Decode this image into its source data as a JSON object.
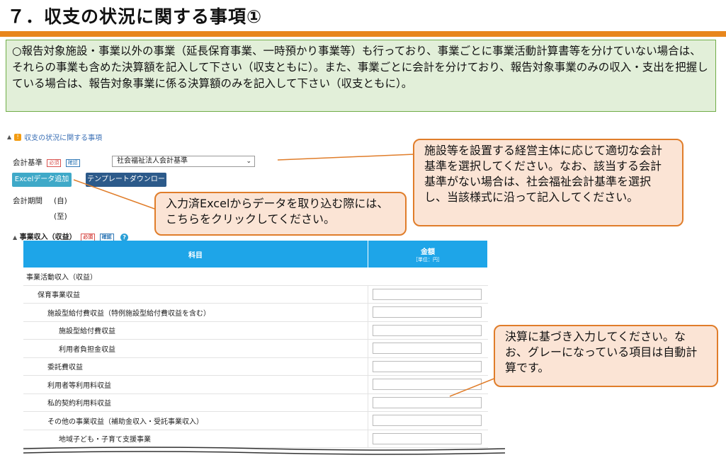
{
  "page": {
    "title": "７．収支の状況に関する事項①",
    "notice": "○報告対象施設・事業以外の事業（延長保育事業、一時預かり事業等）も行っており、事業ごとに事業活動計算書等を分けていない場合は、それらの事業も含めた決算額を記入して下さい（収支ともに）。また、事業ごとに会計を分けており、報告対象事業のみの収入・支出を把握している場合は、報告対象事業に係る決算額のみを記入して下さい（収支ともに）。"
  },
  "form": {
    "section_title": "収支の状況に関する事項",
    "accounting_label": "会計基準",
    "badge_required": "必須",
    "badge_check": "確認",
    "accounting_value": "社会福祉法人会計基準",
    "excel_button": "Excelデータ追加",
    "template_button": "テンプレートダウンロード",
    "period_label": "会計期間",
    "period_from": "(自)",
    "period_to": "(至)",
    "revenue_section": "事業収入（収益）",
    "help": "?"
  },
  "table": {
    "col_item": "科目",
    "col_amount": "金額",
    "col_unit": "［単位：円］",
    "rows": [
      {
        "label": "事業活動収入（収益）"
      },
      {
        "label": "保育事業収益"
      },
      {
        "label": "施設型給付費収益（特例施設型給付費収益を含む）"
      },
      {
        "label": "施設型給付費収益"
      },
      {
        "label": "利用者負担金収益"
      },
      {
        "label": "委託費収益"
      },
      {
        "label": "利用者等利用料収益"
      },
      {
        "label": "私的契約利用料収益"
      },
      {
        "label": "その他の事業収益（補助金収入・受託事業収入）"
      },
      {
        "label": "地域子ども・子育て支援事業"
      }
    ]
  },
  "callouts": {
    "top_right": "施設等を設置する経営主体に応じて適切な会計基準を選択してください。なお、該当する会計基準がない場合は、社会福祉会計基準を選択し、当該様式に沿って記入してください。",
    "middle": "入力済Excelからデータを取り込む際には、こちらをクリックしてください。",
    "bottom_right": "決算に基づき入力してください。なお、グレーになっている項目は自動計算です。"
  },
  "colors": {
    "accent_orange": "#e8861c",
    "notice_bg": "#e2efd9",
    "table_header": "#1ea5e8",
    "callout_bg": "#fbe4d5"
  }
}
